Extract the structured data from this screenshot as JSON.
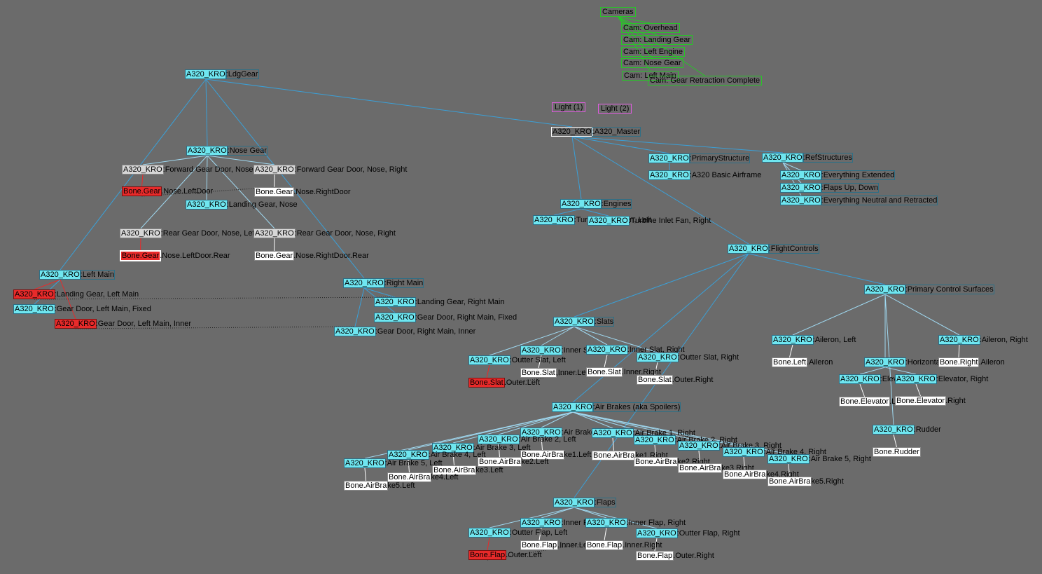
{
  "app": {
    "title": "Scene Hierarchy",
    "background": "#6b6b6b",
    "edge_color": "#3aa0d8",
    "edge_color_light": "#9fd8f0",
    "camera_edge_color": "#28c428"
  },
  "nodes": {
    "cameras": {
      "label": "Cameras"
    },
    "cam_overhead": {
      "label": "Cam: Overhead"
    },
    "cam_landing_gear": {
      "label": "Cam: Landing Gear"
    },
    "cam_left_engine": {
      "label": "Cam: Left Engine"
    },
    "cam_nose_gear": {
      "label": "Cam: Nose Gear"
    },
    "cam_left_main": {
      "label": "Cam: Left Main"
    },
    "cam_gear_retraction": {
      "label": "Cam: Gear Retraction Complete"
    },
    "light1": {
      "label": "Light (1)"
    },
    "light2": {
      "label": "Light (2)"
    },
    "master": {
      "prefix": "A320_KRO",
      "name": ":A320_Master"
    },
    "ldg_gear": {
      "prefix": "A320_KRO",
      "name": ":LdgGear"
    },
    "nose_gear": {
      "prefix": "A320_KRO",
      "name": ":Nose Gear"
    },
    "fwd_door_left": {
      "prefix": "A320_KRO",
      "name": ":Forward Gear Door, Nose, Left"
    },
    "fwd_door_right": {
      "prefix": "A320_KRO",
      "name": ":Forward Gear Door, Nose, Right"
    },
    "bone_nose_leftdoor": {
      "prefix": "Bone.Gear",
      "name": ".Nose.LeftDoor"
    },
    "bone_nose_rightdoor": {
      "prefix": "Bone.Gear",
      "name": ".Nose.RightDoor"
    },
    "landing_gear_nose": {
      "prefix": "A320_KRO",
      "name": ":Landing Gear, Nose"
    },
    "rear_door_left": {
      "prefix": "A320_KRO",
      "name": ":Rear Gear Door, Nose, Left"
    },
    "rear_door_right": {
      "prefix": "A320_KRO",
      "name": ":Rear Gear Door, Nose, Right"
    },
    "bone_nose_leftdoor_rear": {
      "prefix": "Bone.Gear",
      "name": ".Nose.LeftDoor.Rear"
    },
    "bone_nose_rightdoor_rear": {
      "prefix": "Bone.Gear",
      "name": ".Nose.RightDoor.Rear"
    },
    "left_main": {
      "prefix": "A320_KRO",
      "name": ":Left Main"
    },
    "lg_left_main": {
      "prefix": "A320_KRO",
      "name": ":Landing Gear, Left Main"
    },
    "gd_left_main_fixed": {
      "prefix": "A320_KRO",
      "name": ":Gear Door, Left Main, Fixed"
    },
    "gd_left_main_inner": {
      "prefix": "A320_KRO",
      "name": ":Gear Door, Left Main, Inner"
    },
    "right_main": {
      "prefix": "A320_KRO",
      "name": ":Right Main"
    },
    "lg_right_main": {
      "prefix": "A320_KRO",
      "name": ":Landing Gear, Right Main"
    },
    "gd_right_main_fixed": {
      "prefix": "A320_KRO",
      "name": ":Gear Door, Right Main, Fixed"
    },
    "gd_right_main_inner": {
      "prefix": "A320_KRO",
      "name": ":Gear Door, Right Main, Inner"
    },
    "primary_structure": {
      "prefix": "A320_KRO",
      "name": ":PrimaryStructure"
    },
    "basic_airframe": {
      "prefix": "A320_KRO",
      "name": ":A320 Basic Airframe"
    },
    "ref_structures": {
      "prefix": "A320_KRO",
      "name": ":RefStructures"
    },
    "everything_extended": {
      "prefix": "A320_KRO",
      "name": ":Everything Extended"
    },
    "flaps_up_down": {
      "prefix": "A320_KRO",
      "name": ":Flaps Up, Down"
    },
    "everything_neutral": {
      "prefix": "A320_KRO",
      "name": ":Everything Neutral and Retracted"
    },
    "engines": {
      "prefix": "A320_KRO",
      "name": ":Engines"
    },
    "turbine_left": {
      "prefix": "A320_KRO",
      "name": ":Turbine Inlet Fan, Left"
    },
    "turbine_right": {
      "prefix": "A320_KRO",
      "name": ":Turbine Inlet Fan, Right"
    },
    "flight_controls": {
      "prefix": "A320_KRO",
      "name": ":FlightControls"
    },
    "primary_surfaces": {
      "prefix": "A320_KRO",
      "name": ":Primary Control Surfaces"
    },
    "aileron_left": {
      "prefix": "A320_KRO",
      "name": ":Aileron, Left"
    },
    "aileron_right": {
      "prefix": "A320_KRO",
      "name": ":Aileron, Right"
    },
    "bone_left_aileron": {
      "prefix": "Bone.Left",
      "name": ".Aileron"
    },
    "bone_right_aileron": {
      "prefix": "Bone.Right",
      "name": ".Aileron"
    },
    "horizontal_stab": {
      "prefix": "A320_KRO",
      "name": ":Horizontal Stabilizer"
    },
    "elevator_left": {
      "prefix": "A320_KRO",
      "name": ":Elevator, Left"
    },
    "elevator_right": {
      "prefix": "A320_KRO",
      "name": ":Elevator, Right"
    },
    "bone_elevator_left": {
      "prefix": "Bone.Elevator",
      "name": ".Left"
    },
    "bone_elevator_right": {
      "prefix": "Bone.Elevator",
      "name": ".Right"
    },
    "rudder": {
      "prefix": "A320_KRO",
      "name": ":Rudder"
    },
    "bone_rudder": {
      "prefix": "Bone.Rudder",
      "name": ""
    },
    "slats": {
      "prefix": "A320_KRO",
      "name": ":Slats"
    },
    "inner_slat_left": {
      "prefix": "A320_KRO",
      "name": ":Inner Slat, Left"
    },
    "inner_slat_right": {
      "prefix": "A320_KRO",
      "name": ":Inner Slat, Right"
    },
    "outter_slat_left": {
      "prefix": "A320_KRO",
      "name": ":Outter Slat, Left"
    },
    "outter_slat_right": {
      "prefix": "A320_KRO",
      "name": ":Outter Slat, Right"
    },
    "bone_slat_inner_left": {
      "prefix": "Bone.Slat",
      "name": ".Inner.Left"
    },
    "bone_slat_inner_right": {
      "prefix": "Bone.Slat",
      "name": ".Inner.Right"
    },
    "bone_slat_outer_left": {
      "prefix": "Bone.Slat",
      "name": ".Outer.Left"
    },
    "bone_slat_outer_right": {
      "prefix": "Bone.Slat",
      "name": ".Outer.Right"
    },
    "air_brakes": {
      "prefix": "A320_KRO",
      "name": ":Air Brakes (aka Spoilers)"
    },
    "ab1_left": {
      "prefix": "A320_KRO",
      "name": ":Air Brake 1, Left"
    },
    "ab2_left": {
      "prefix": "A320_KRO",
      "name": ":Air Brake 2, Left"
    },
    "ab3_left": {
      "prefix": "A320_KRO",
      "name": ":Air Brake 3, Left"
    },
    "ab4_left": {
      "prefix": "A320_KRO",
      "name": ":Air Brake 4, Left"
    },
    "ab5_left": {
      "prefix": "A320_KRO",
      "name": ":Air Brake 5, Left"
    },
    "ab1_right": {
      "prefix": "A320_KRO",
      "name": ":Air Brake 1, Right"
    },
    "ab2_right": {
      "prefix": "A320_KRO",
      "name": ":Air Brake 2, Right"
    },
    "ab3_right": {
      "prefix": "A320_KRO",
      "name": ":Air Brake 3, Right"
    },
    "ab4_right": {
      "prefix": "A320_KRO",
      "name": ":Air Brake 4, Right"
    },
    "ab5_right": {
      "prefix": "A320_KRO",
      "name": ":Air Brake 5, Right"
    },
    "bone_ab1_left": {
      "prefix": "Bone.AirBra",
      "name": "ke1.Left"
    },
    "bone_ab2_left": {
      "prefix": "Bone.AirBra",
      "name": "ke2.Left"
    },
    "bone_ab3_left": {
      "prefix": "Bone.AirBra",
      "name": "ke3.Left"
    },
    "bone_ab4_left": {
      "prefix": "Bone.AirBra",
      "name": "ke4.Left"
    },
    "bone_ab5_left": {
      "prefix": "Bone.AirBra",
      "name": "ke5.Left"
    },
    "bone_ab1_right": {
      "prefix": "Bone.AirBra",
      "name": "ke1.Right"
    },
    "bone_ab2_right": {
      "prefix": "Bone.AirBra",
      "name": "ke2.Right"
    },
    "bone_ab3_right": {
      "prefix": "Bone.AirBra",
      "name": "ke3.Right"
    },
    "bone_ab4_right": {
      "prefix": "Bone.AirBra",
      "name": "ke4.Right"
    },
    "bone_ab5_right": {
      "prefix": "Bone.AirBra",
      "name": "ke5.Right"
    },
    "flaps": {
      "prefix": "A320_KRO",
      "name": ":Flaps"
    },
    "inner_flap_left": {
      "prefix": "A320_KRO",
      "name": ":Inner Flap, Left"
    },
    "inner_flap_right": {
      "prefix": "A320_KRO",
      "name": ":Inner Flap, Right"
    },
    "outter_flap_left": {
      "prefix": "A320_KRO",
      "name": ":Outter Flap, Left"
    },
    "outter_flap_right": {
      "prefix": "A320_KRO",
      "name": ":Outter Flap, Right"
    },
    "bone_flap_inner_left": {
      "prefix": "Bone.Flap",
      "name": ".Inner.Left"
    },
    "bone_flap_inner_right": {
      "prefix": "Bone.Flap",
      "name": ".Inner.Right"
    },
    "bone_flap_outer_left": {
      "prefix": "Bone.Flap",
      "name": ".Outer.Left"
    },
    "bone_flap_outer_right": {
      "prefix": "Bone.Flap",
      "name": ".Outer.Right"
    }
  }
}
